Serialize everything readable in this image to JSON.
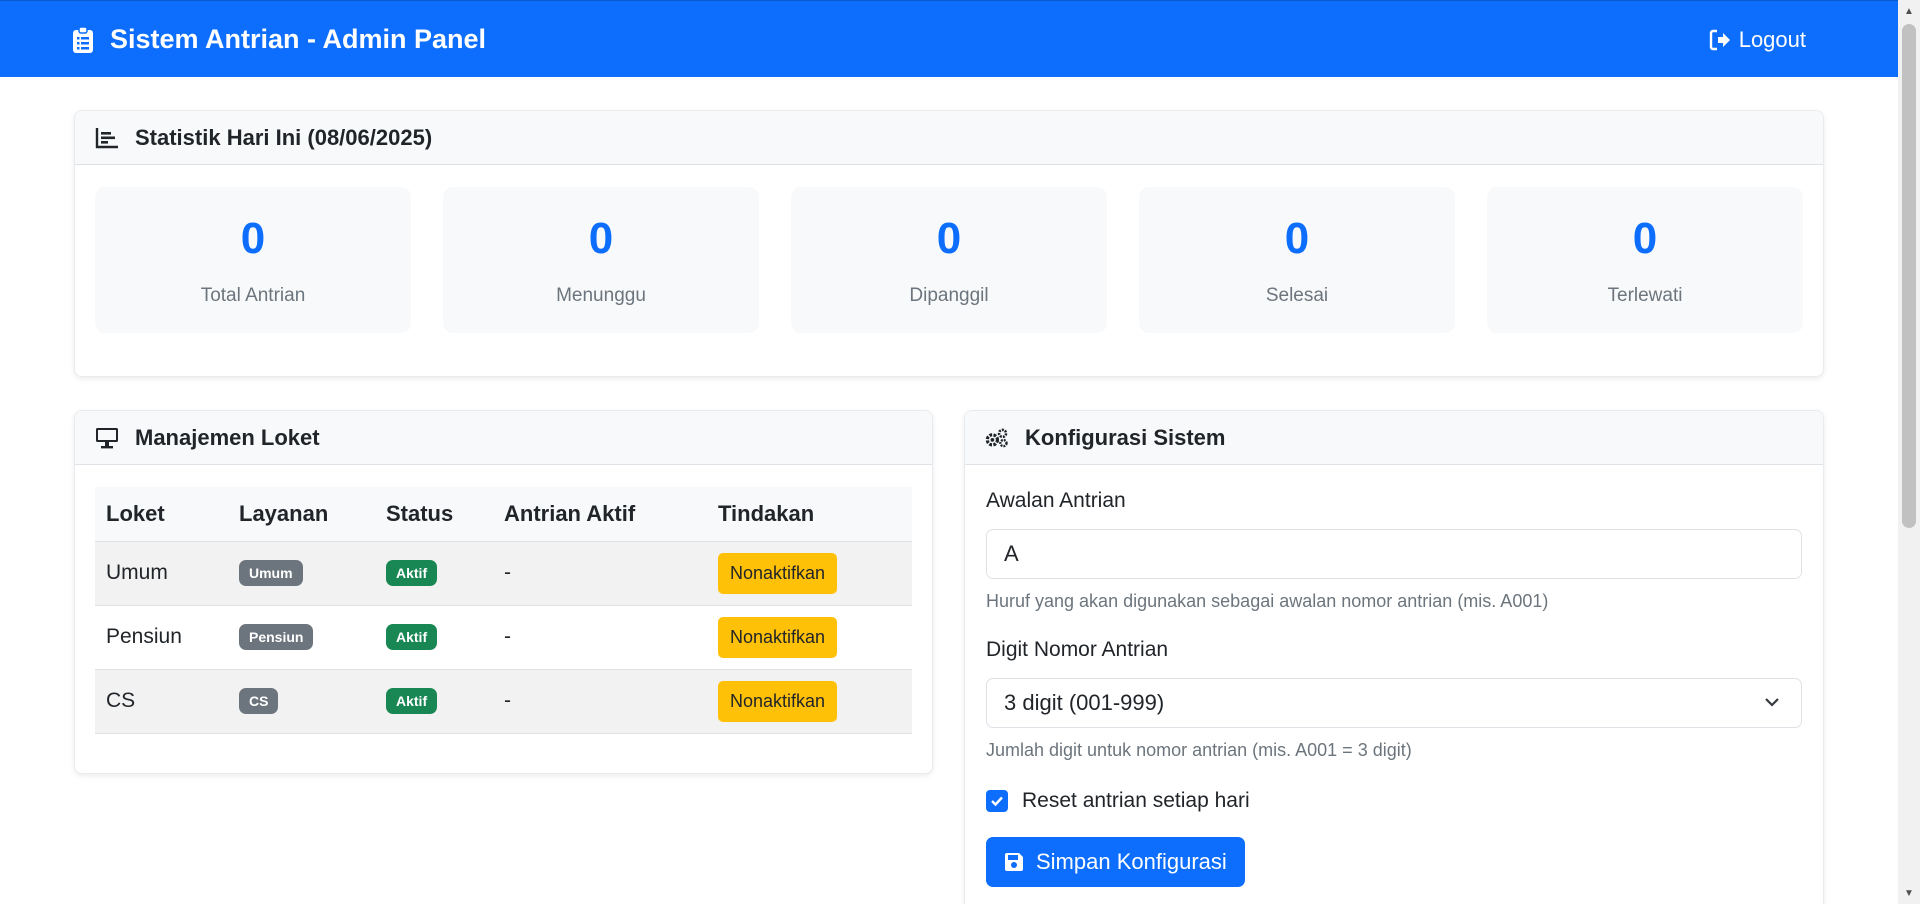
{
  "navbar": {
    "title": "Sistem Antrian - Admin Panel",
    "logout_label": "Logout"
  },
  "stats": {
    "header": "Statistik Hari Ini (08/06/2025)",
    "items": [
      {
        "value": "0",
        "label": "Total Antrian"
      },
      {
        "value": "0",
        "label": "Menunggu"
      },
      {
        "value": "0",
        "label": "Dipanggil"
      },
      {
        "value": "0",
        "label": "Selesai"
      },
      {
        "value": "0",
        "label": "Terlewati"
      }
    ]
  },
  "loket": {
    "header": "Manajemen Loket",
    "columns": [
      "Loket",
      "Layanan",
      "Status",
      "Antrian Aktif",
      "Tindakan"
    ],
    "rows": [
      {
        "loket": "Umum",
        "layanan": "Umum",
        "status": "Aktif",
        "antrian": "-",
        "action": "Nonaktifkan"
      },
      {
        "loket": "Pensiun",
        "layanan": "Pensiun",
        "status": "Aktif",
        "antrian": "-",
        "action": "Nonaktifkan"
      },
      {
        "loket": "CS",
        "layanan": "CS",
        "status": "Aktif",
        "antrian": "-",
        "action": "Nonaktifkan"
      }
    ]
  },
  "config": {
    "header": "Konfigurasi Sistem",
    "prefix_label": "Awalan Antrian",
    "prefix_value": "A",
    "prefix_help": "Huruf yang akan digunakan sebagai awalan nomor antrian (mis. A001)",
    "digit_label": "Digit Nomor Antrian",
    "digit_value": "3 digit (001-999)",
    "digit_help": "Jumlah digit untuk nomor antrian (mis. A001 = 3 digit)",
    "reset_label": "Reset antrian setiap hari",
    "reset_checked": true,
    "save_label": "Simpan Konfigurasi"
  },
  "colors": {
    "primary": "#0d6efd",
    "success": "#198754",
    "secondary": "#6c757d",
    "warning": "#ffc107"
  }
}
